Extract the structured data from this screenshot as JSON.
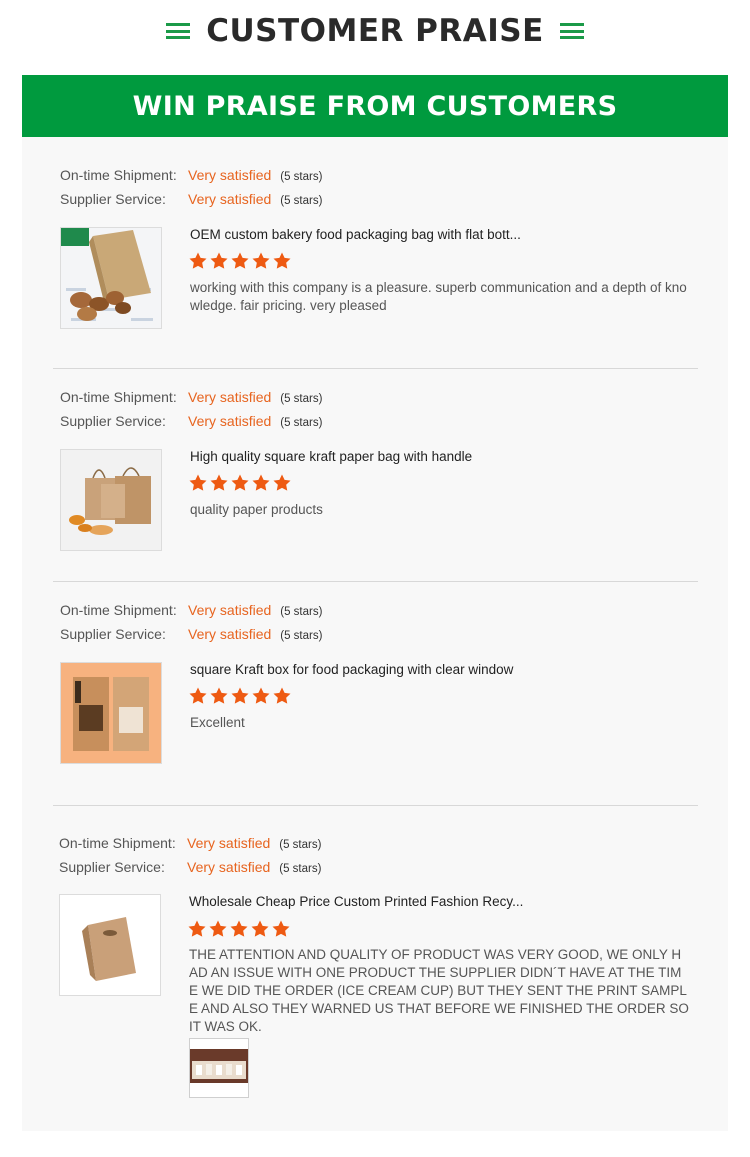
{
  "header": {
    "title": "CUSTOMER PRAISE"
  },
  "banner": {
    "title": "WIN PRAISE FROM CUSTOMERS"
  },
  "labels": {
    "shipment": "On-time Shipment:",
    "service": "Supplier Service:"
  },
  "colors": {
    "accent_green": "#009a3e",
    "rating_orange": "#e7641f",
    "star": "#ee5a12"
  },
  "reviews": [
    {
      "shipment_rating": "Very satisfied",
      "shipment_stars": "(5 stars)",
      "service_rating": "Very satisfied",
      "service_stars": "(5 stars)",
      "product_title": "OEM custom bakery food packaging bag with flat bott...",
      "stars": 5,
      "comment": "working with this company is a pleasure.  superb communication and a depth of knowledge.  fair pricing.  very pleased"
    },
    {
      "shipment_rating": "Very satisfied",
      "shipment_stars": "(5 stars)",
      "service_rating": "Very satisfied",
      "service_stars": "(5 stars)",
      "product_title": "High quality square kraft paper bag with handle",
      "stars": 5,
      "comment": "quality paper products"
    },
    {
      "shipment_rating": "Very satisfied",
      "shipment_stars": "(5 stars)",
      "service_rating": "Very satisfied",
      "service_stars": "(5 stars)",
      "product_title": "square Kraft box for food packaging with clear window",
      "stars": 5,
      "comment": "Excellent"
    },
    {
      "shipment_rating": "Very satisfied",
      "shipment_stars": "(5 stars)",
      "service_rating": "Very satisfied",
      "service_stars": "(5 stars)",
      "product_title": "Wholesale Cheap Price Custom Printed Fashion Recy...",
      "stars": 5,
      "comment": "THE ATTENTION AND QUALITY OF PRODUCT WAS VERY GOOD, WE ONLY HAD AN ISSUE WITH ONE PRODUCT THE SUPPLIER DIDN´T HAVE AT THE TIME WE DID THE ORDER (ICE CREAM CUP) BUT THEY SENT THE PRINT SAMPLE AND ALSO THEY WARNED US THAT BEFORE WE FINISHED THE ORDER SO IT WAS OK."
    }
  ]
}
